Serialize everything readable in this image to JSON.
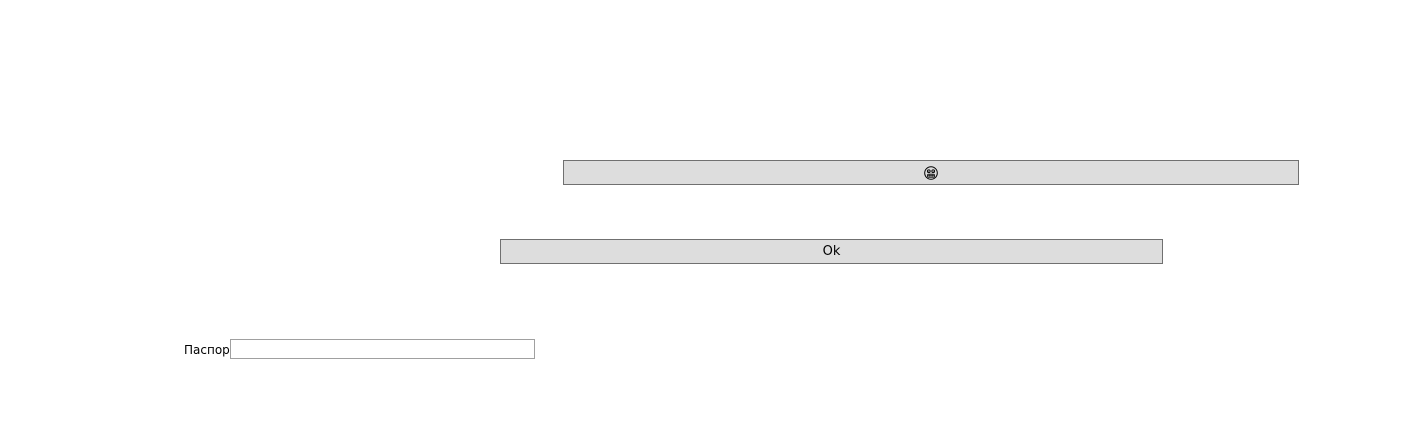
{
  "buttons": {
    "emoji_button": {
      "icon": "grimacing-face-icon"
    },
    "ok_button": {
      "label": "Ok"
    }
  },
  "form": {
    "passport_label": "Паспорт",
    "passport_value": "",
    "passport_placeholder": ""
  },
  "colors": {
    "background": "#ffffff",
    "button_face": "#dddddd",
    "button_border": "#707070",
    "input_border": "#a0a0a0"
  }
}
